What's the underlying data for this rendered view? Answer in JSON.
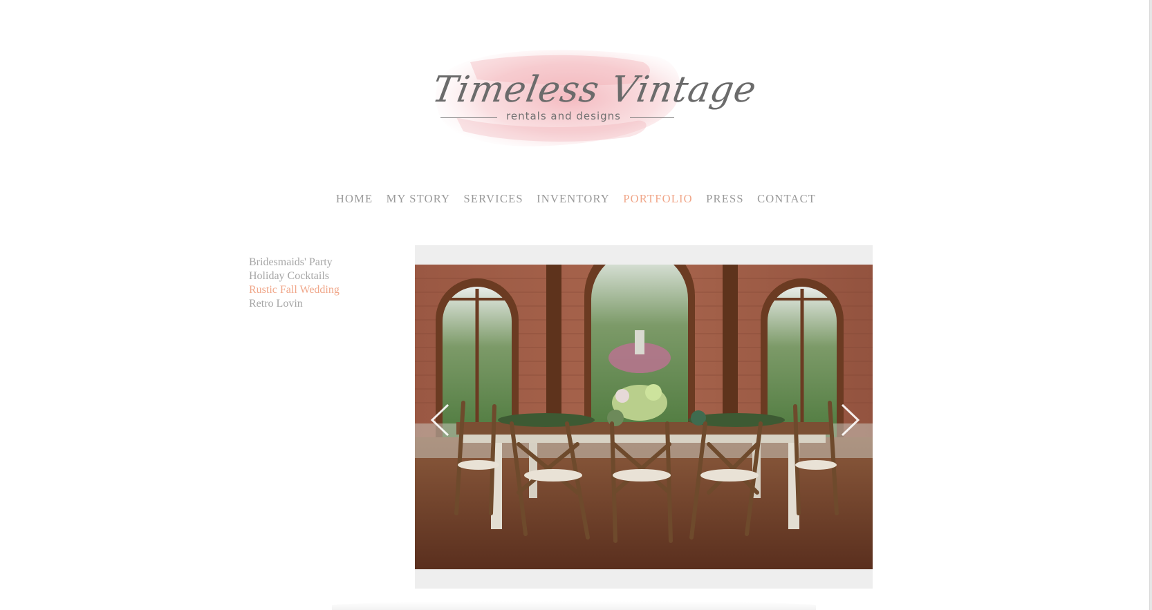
{
  "logo": {
    "title": "Timeless Vintage",
    "subtitle": "rentals and designs"
  },
  "nav": {
    "items": [
      "HOME",
      "MY STORY",
      "SERVICES",
      "INVENTORY",
      "PORTFOLIO",
      "PRESS",
      "CONTACT"
    ],
    "active": "PORTFOLIO"
  },
  "portfolio": {
    "categories": [
      "Bridesmaids' Party",
      "Holiday Cocktails",
      "Rustic Fall Wedding",
      "Retro Lovin"
    ],
    "active": "Rustic Fall Wedding"
  },
  "gallery": {
    "prev_icon": "chevron-left-icon",
    "next_icon": "chevron-right-icon"
  },
  "colors": {
    "accent": "#f0a78a",
    "nav_text": "#9a9a9a",
    "gallery_bg": "#eeeeee",
    "logo_wash": "#f4c3c8"
  }
}
